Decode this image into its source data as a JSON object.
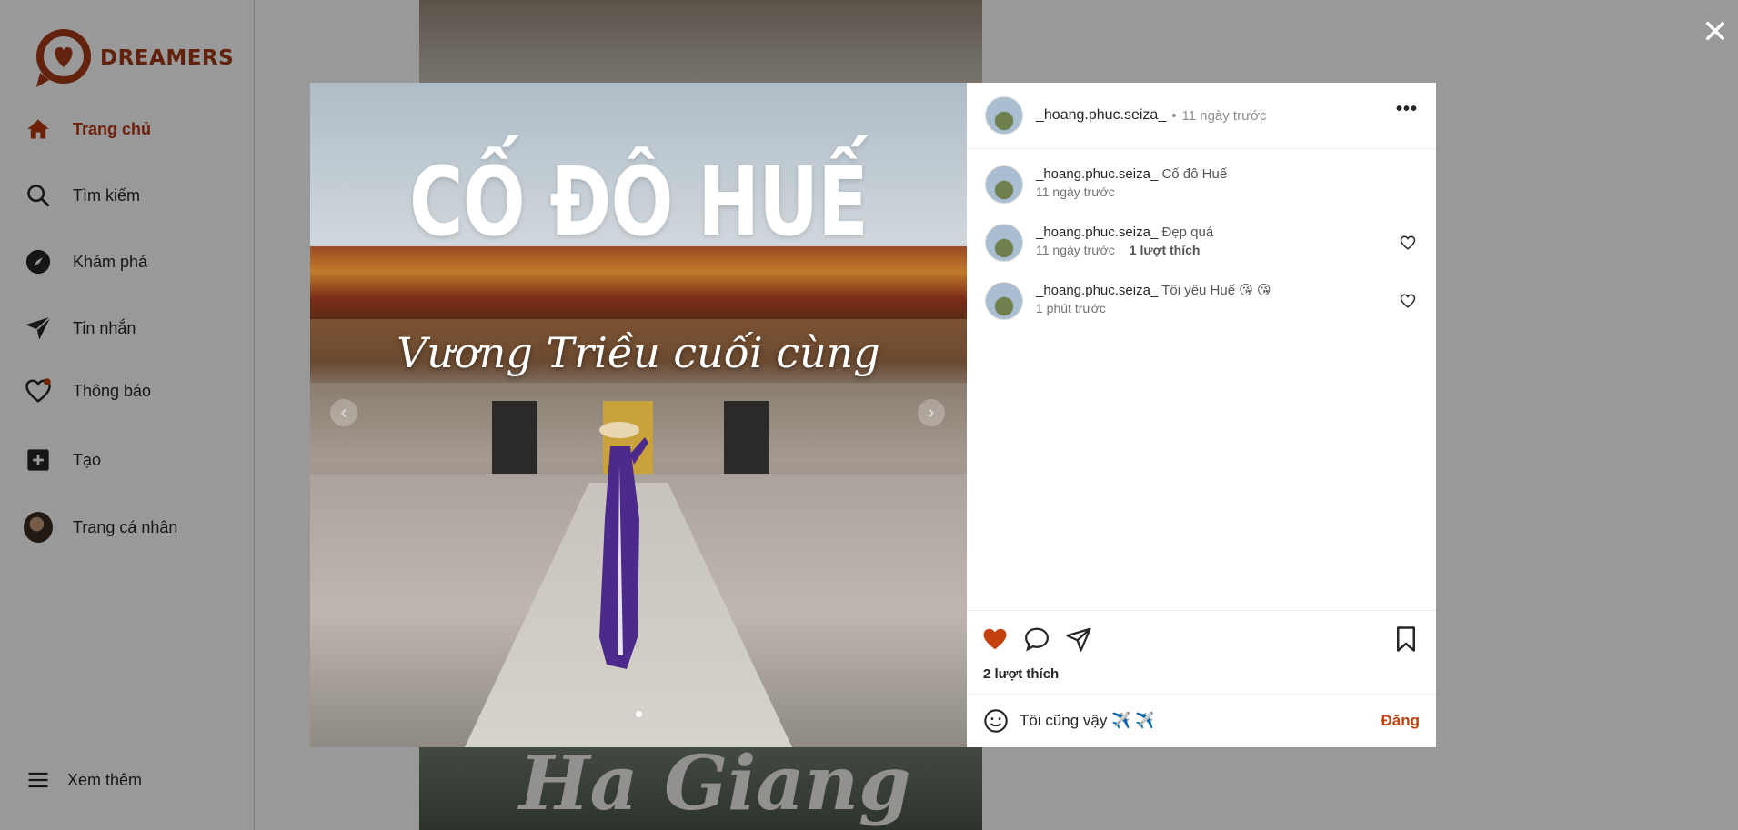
{
  "brand": {
    "name": "DREAMERS",
    "color": "#a53a17"
  },
  "sidebar": {
    "items": [
      {
        "label": "Trang chủ",
        "icon": "home-icon"
      },
      {
        "label": "Tìm kiếm",
        "icon": "search-icon"
      },
      {
        "label": "Khám phá",
        "icon": "compass-icon"
      },
      {
        "label": "Tin nhắn",
        "icon": "send-icon"
      },
      {
        "label": "Thông báo",
        "icon": "heart-icon"
      },
      {
        "label": "Tạo",
        "icon": "plus-square-icon"
      },
      {
        "label": "Trang cá nhân",
        "icon": "avatar"
      }
    ],
    "more_label": "Xem thêm"
  },
  "feed": {
    "next_post_text": "Ha Giang"
  },
  "post": {
    "image_title": "CỐ ĐÔ HUẾ",
    "image_subtitle": "Vương Triều cuối cùng",
    "author": "_hoang.phuc.seiza_",
    "time": "11 ngày trước",
    "likes_text": "2 lượt thích",
    "comments": [
      {
        "user": "_hoang.phuc.seiza_",
        "text": "Cố đô Huế",
        "time": "11 ngày trước",
        "likes": ""
      },
      {
        "user": "_hoang.phuc.seiza_",
        "text": "Đẹp quá",
        "time": "11 ngày trước",
        "likes": "1 lượt thích"
      },
      {
        "user": "_hoang.phuc.seiza_",
        "text": "Tôi yêu Huế 😘 😘",
        "time": "1 phút trước",
        "likes": ""
      }
    ],
    "comment_input": {
      "value": "Tôi cũng vậy ✈️ ✈️",
      "post_label": "Đăng"
    }
  },
  "colors": {
    "accent": "#b8360f",
    "liked": "#c2410c"
  }
}
